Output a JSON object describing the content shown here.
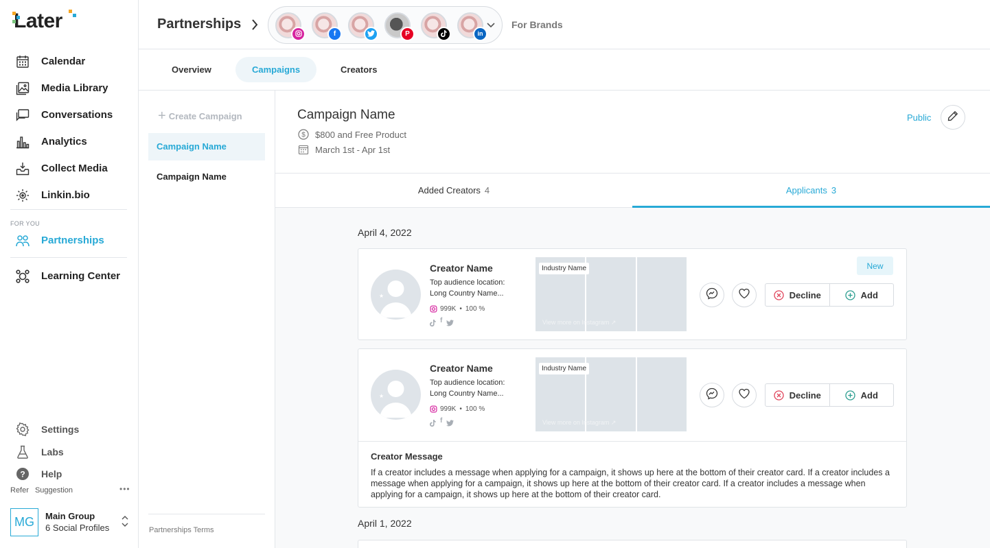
{
  "app": {
    "logo_text": "Later"
  },
  "sidebar": {
    "nav": [
      {
        "label": "Calendar",
        "icon": "calendar-icon"
      },
      {
        "label": "Media Library",
        "icon": "media-library-icon"
      },
      {
        "label": "Conversations",
        "icon": "conversations-icon"
      },
      {
        "label": "Analytics",
        "icon": "analytics-icon"
      },
      {
        "label": "Collect Media",
        "icon": "collect-media-icon"
      },
      {
        "label": "Linkin.bio",
        "icon": "linkin-bio-icon"
      }
    ],
    "section_label": "FOR YOU",
    "partnerships_label": "Partnerships",
    "learning_label": "Learning Center",
    "bottom": [
      {
        "label": "Settings",
        "icon": "settings-icon"
      },
      {
        "label": "Labs",
        "icon": "labs-icon"
      },
      {
        "label": "Help",
        "icon": "help-icon"
      }
    ],
    "refer": "Refer",
    "suggestion": "Suggestion",
    "more": "•••",
    "group": {
      "initials": "MG",
      "name": "Main Group",
      "profiles": "6 Social Profiles"
    }
  },
  "topbar": {
    "title": "Partnerships",
    "profiles": [
      {
        "network": "instagram",
        "badge_color": "#d6249f"
      },
      {
        "network": "facebook",
        "badge_color": "#1877f2"
      },
      {
        "network": "twitter",
        "badge_color": "#1da1f2"
      },
      {
        "network": "pinterest",
        "badge_color": "#e60023"
      },
      {
        "network": "tiktok",
        "badge_color": "#000000"
      },
      {
        "network": "linkedin",
        "badge_color": "#0a66c2"
      }
    ],
    "brands_label": "For Brands"
  },
  "tabs": {
    "overview": "Overview",
    "campaigns": "Campaigns",
    "creators": "Creators"
  },
  "campaign_list": {
    "create_label": "Create Campaign",
    "items": [
      "Campaign Name",
      "Campaign Name"
    ],
    "terms": "Partnerships Terms"
  },
  "campaign": {
    "name": "Campaign Name",
    "compensation": "$800 and Free Product",
    "dates": "March 1st - Apr 1st",
    "visibility": "Public"
  },
  "subtabs": {
    "added_label": "Added Creators",
    "added_count": "4",
    "applicants_label": "Applicants",
    "applicants_count": "3"
  },
  "dates": [
    "April 4, 2022",
    "April 1, 2022"
  ],
  "applicants": [
    {
      "name": "Creator Name",
      "location_label": "Top audience location:",
      "location": "Long Country Name...",
      "followers": "999K",
      "match": "100 %",
      "industry": "Industry Name",
      "view_more": "View more on Instagram ↗",
      "badge": "New",
      "decline": "Decline",
      "add": "Add"
    },
    {
      "name": "Creator Name",
      "location_label": "Top audience location:",
      "location": "Long Country Name...",
      "followers": "999K",
      "match": "100 %",
      "industry": "Industry Name",
      "view_more": "View more on Instagram ↗",
      "decline": "Decline",
      "add": "Add",
      "message_title": "Creator Message",
      "message": "If a creator includes a message when applying for a campaign, it shows up here at the bottom of their creator card. If a creator includes a message when applying for a campaign, it shows up here at the bottom of their creator card. If a creator includes a message when applying for a campaign, it shows up here at the bottom of their creator card."
    }
  ],
  "colors": {
    "accent": "#27a9d6",
    "border": "#e3e6ea",
    "decline": "#e0445a",
    "add": "#2a9d8f"
  }
}
